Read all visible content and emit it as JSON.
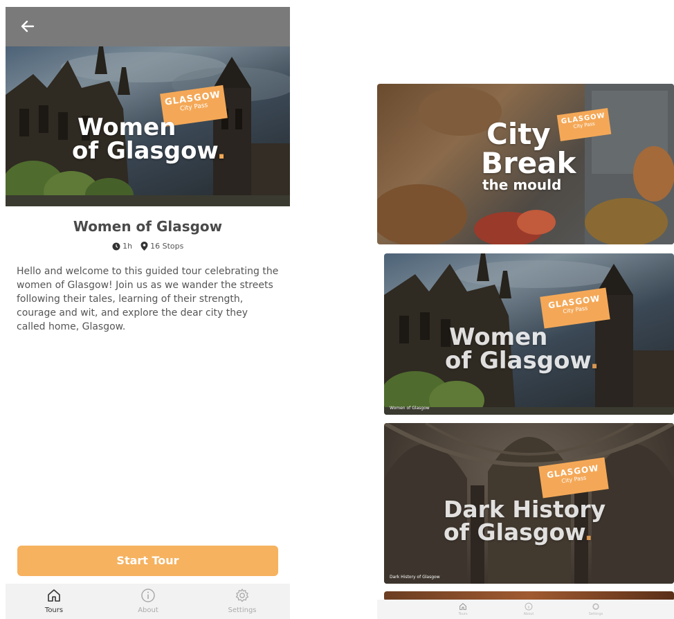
{
  "left_screen": {
    "hero": {
      "badge_line1": "GLASGOW",
      "badge_line2": "City Pass",
      "title_line1": "Women",
      "title_line2": "of Glasgow",
      "title_dot": "."
    },
    "tour": {
      "title": "Women of Glasgow",
      "duration": "1h",
      "stops": "16 Stops",
      "description": "Hello and welcome to this guided tour celebrating the women of Glasgow! Join us as we wander the streets following their tales, learning of their strength, courage and wit, and explore the dear city they called home, Glasgow."
    },
    "start_button": "Start Tour",
    "nav": [
      {
        "label": "Tours",
        "icon": "home-icon"
      },
      {
        "label": "About",
        "icon": "info-icon"
      },
      {
        "label": "Settings",
        "icon": "gear-icon"
      }
    ]
  },
  "right_screen": {
    "cards": [
      {
        "badge_line1": "GLASGOW",
        "badge_line2": "City Pass",
        "title_line1": "City",
        "title_line2": "Break",
        "title_line3": "the mould",
        "caption": ""
      },
      {
        "badge_line1": "GLASGOW",
        "badge_line2": "City Pass",
        "title_line1": "Women",
        "title_line2": "of Glasgow",
        "title_dot": ".",
        "caption": "Women of Glasgow"
      },
      {
        "badge_line1": "GLASGOW",
        "badge_line2": "City Pass",
        "title_line1": "Dark History",
        "title_line2": "of Glasgow",
        "title_dot": ".",
        "caption": "Dark History of Glasgow"
      }
    ],
    "nav": [
      {
        "label": "Tours",
        "icon": "home-icon"
      },
      {
        "label": "About",
        "icon": "info-icon"
      },
      {
        "label": "Settings",
        "icon": "gear-icon"
      }
    ]
  },
  "colors": {
    "accent": "#f6b25f",
    "top_bar": "#7a7a7a",
    "text": "#555555"
  }
}
